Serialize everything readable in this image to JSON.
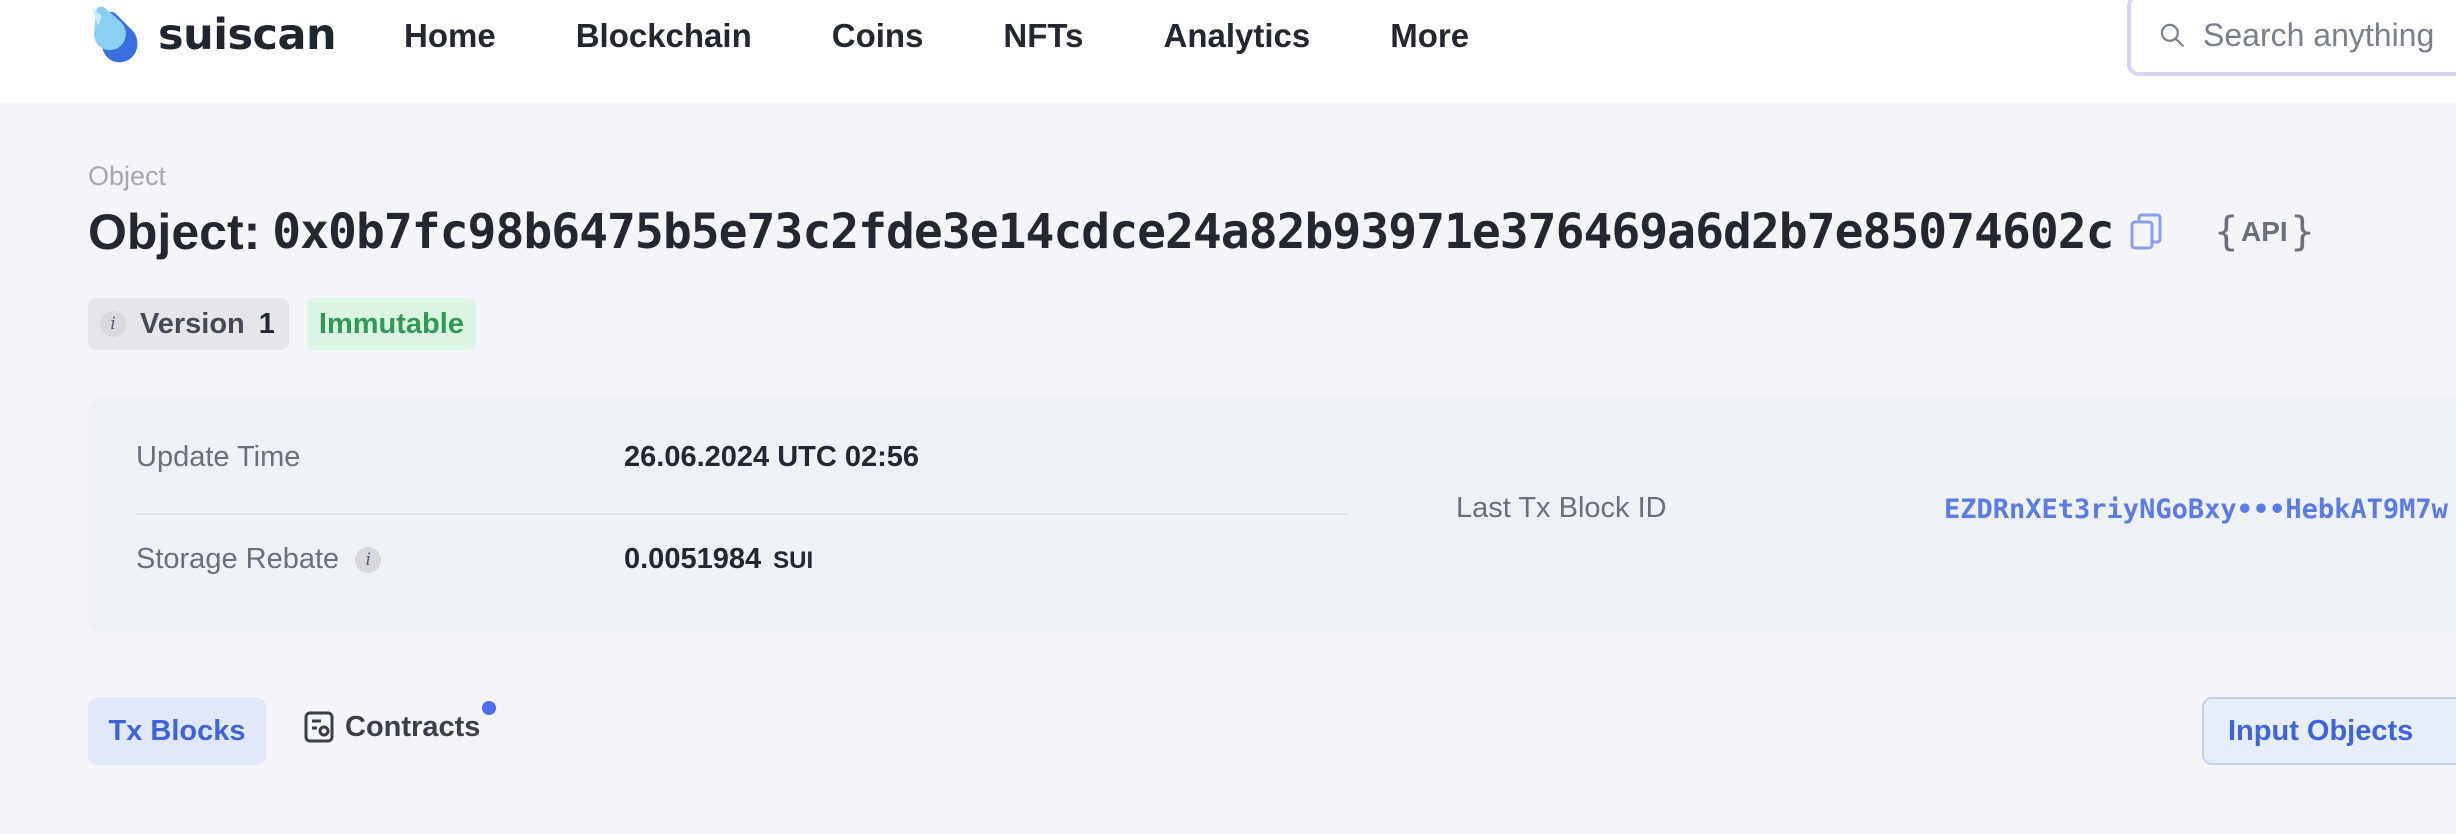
{
  "nav": {
    "brand": "suiscan",
    "items": [
      "Home",
      "Blockchain",
      "Coins",
      "NFTs",
      "Analytics",
      "More"
    ],
    "search_placeholder": "Search anything"
  },
  "header": {
    "breadcrumb": "Object",
    "title_prefix": "Object:",
    "object_id": "0x0b7fc98b6475b5e73c2fde3e14cdce24a82b93971e376469a6d2b7e85074602c",
    "api_label": "API"
  },
  "badges": {
    "version_label": "Version",
    "version_value": "1",
    "status": "Immutable"
  },
  "details": {
    "update_time_label": "Update Time",
    "update_time_value": "26.06.2024 UTC 02:56",
    "storage_rebate_label": "Storage Rebate",
    "storage_rebate_value": "0.0051984",
    "storage_rebate_unit": "SUI",
    "last_tx_label": "Last Tx Block ID",
    "last_tx_value": "EZDRnXEt3riyNGoBxy•••HebkAT9M7w"
  },
  "tabs": {
    "active": "Tx Blocks",
    "contracts": "Contracts",
    "input_objects": "Input Objects"
  },
  "colors": {
    "accent": "#3d63dd",
    "link": "#5b7be6",
    "immutable_text": "#2f9a56",
    "immutable_bg": "#dcf5e3"
  },
  "icons": [
    "suiscan-logo-icon",
    "search-icon",
    "copy-icon",
    "info-icon",
    "contracts-icon"
  ]
}
